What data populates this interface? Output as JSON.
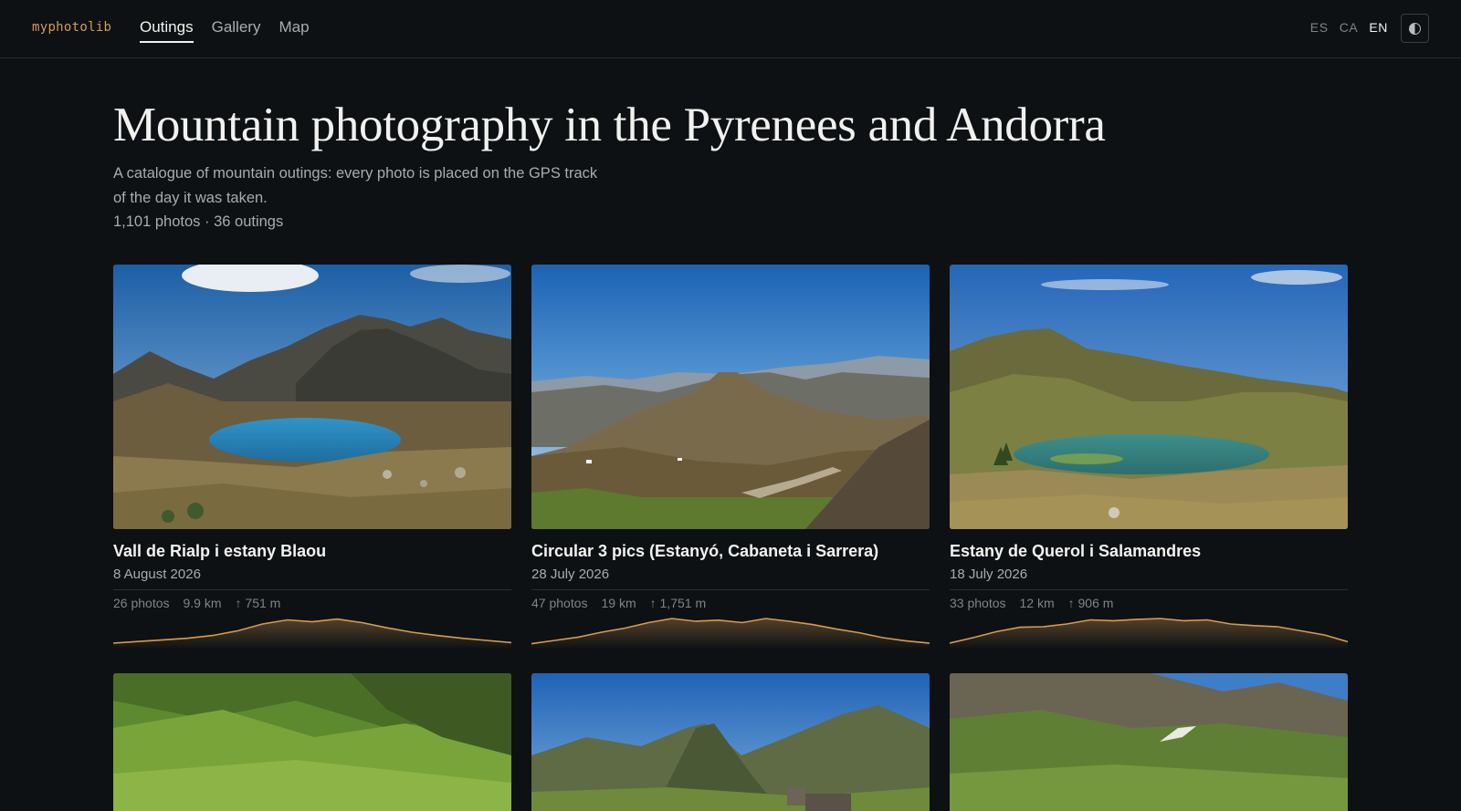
{
  "brand": "myphotolib",
  "nav": {
    "items": [
      "Outings",
      "Gallery",
      "Map"
    ],
    "active": 0
  },
  "langs": {
    "items": [
      "ES",
      "CA",
      "EN"
    ],
    "active": 2
  },
  "theme_toggle": {
    "icon": "half-circle-icon"
  },
  "hero": {
    "title": "Mountain photography in the Pyrenees and Andorra",
    "subtitle": "A catalogue of mountain outings: every photo is placed on the GPS track of the day it was taken.",
    "stats": "1,101 photos · 36 outings"
  },
  "colors": {
    "accent": "#d99a4e",
    "background": "#0d1114"
  },
  "outings": [
    {
      "title": "Vall de Rialp i estany Blaou",
      "date": "8 August 2026",
      "photos": "26 photos",
      "distance": "9.9 km",
      "gain": "751 m",
      "elevation_profile": [
        0.1,
        0.16,
        0.22,
        0.28,
        0.38,
        0.55,
        0.8,
        0.95,
        0.88,
        0.98,
        0.85,
        0.66,
        0.5,
        0.38,
        0.28,
        0.2,
        0.12
      ]
    },
    {
      "title": "Circular 3 pics (Estanyó, Cabaneta i Sarrera)",
      "date": "28 July 2026",
      "photos": "47 photos",
      "distance": "19 km",
      "gain": "1,751 m",
      "elevation_profile": [
        0.08,
        0.2,
        0.32,
        0.5,
        0.65,
        0.85,
        1.0,
        0.9,
        0.94,
        0.85,
        1.0,
        0.9,
        0.78,
        0.62,
        0.48,
        0.3,
        0.18,
        0.1
      ]
    },
    {
      "title": "Estany de Querol i Salamandres",
      "date": "18 July 2026",
      "photos": "33 photos",
      "distance": "12 km",
      "gain": "906 m",
      "elevation_profile": [
        0.1,
        0.3,
        0.52,
        0.68,
        0.7,
        0.8,
        0.95,
        0.92,
        0.97,
        1.0,
        0.92,
        0.95,
        0.8,
        0.74,
        0.7,
        0.55,
        0.4,
        0.15
      ]
    }
  ]
}
